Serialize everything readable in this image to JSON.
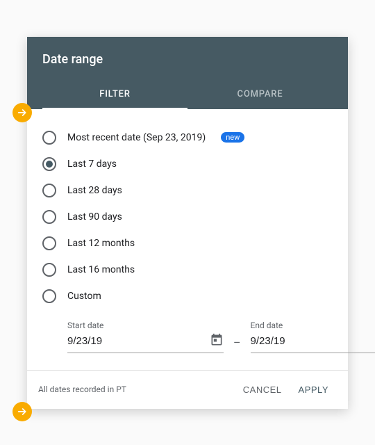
{
  "title": "Date range",
  "tabs": {
    "filter": "FILTER",
    "compare": "COMPARE"
  },
  "options": [
    "Most recent date (Sep 23, 2019)",
    "Last 7 days",
    "Last 28 days",
    "Last 90 days",
    "Last 12 months",
    "Last 16 months",
    "Custom"
  ],
  "newBadge": "new",
  "dates": {
    "startLabel": "Start date",
    "startValue": "9/23/19",
    "endLabel": "End date",
    "endValue": "9/23/19"
  },
  "footerNote": "All dates recorded in PT",
  "buttons": {
    "cancel": "CANCEL",
    "apply": "APPLY"
  }
}
